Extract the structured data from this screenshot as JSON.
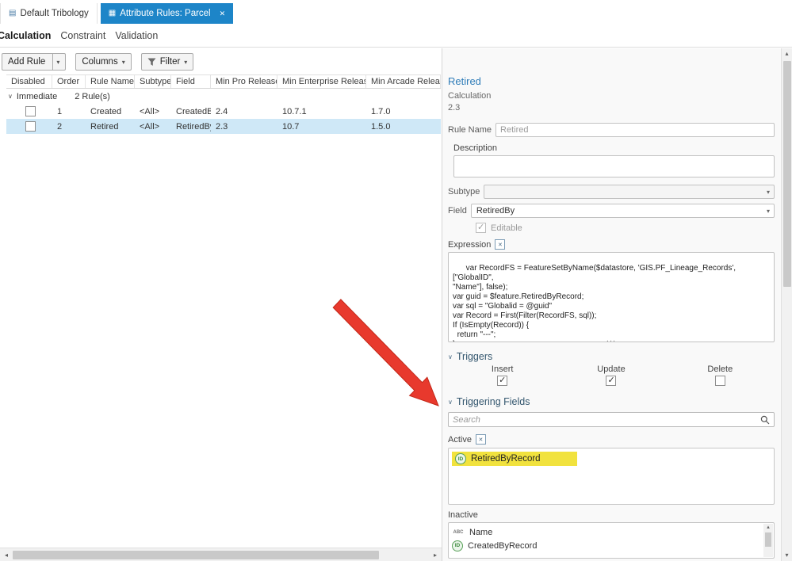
{
  "colors": {
    "accent_blue": "#1d85c8",
    "selected_row": "#cfe8f7",
    "highlight_yellow": "#f1e23e",
    "arrow_red": "#e8392d",
    "title_blue": "#2e7cb8"
  },
  "tabs": [
    {
      "label": "Default Tribology",
      "active": false
    },
    {
      "label": "Attribute Rules: Parcel",
      "active": true
    }
  ],
  "subtabs": {
    "calculation": "Calculation",
    "constraint": "Constraint",
    "validation": "Validation"
  },
  "toolbar": {
    "add_rule_label": "Add Rule",
    "columns_label": "Columns",
    "filter_label": "Filter"
  },
  "table": {
    "headers": [
      "Disabled",
      "Order",
      "Rule Name",
      "Subtype",
      "Field",
      "Min Pro Release",
      "Min Enterprise Release",
      "Min Arcade Release"
    ],
    "group_label": "Immediate",
    "group_count": "2 Rule(s)",
    "rows": [
      {
        "disabled": false,
        "order": "1",
        "rule_name": "Created",
        "subtype": "<All>",
        "field": "CreatedBy",
        "min_pro": "2.4",
        "min_enterprise": "10.7.1",
        "min_arcade": "1.7.0",
        "selected": false
      },
      {
        "disabled": false,
        "order": "2",
        "rule_name": "Retired",
        "subtype": "<All>",
        "field": "RetiredBy",
        "min_pro": "2.3",
        "min_enterprise": "10.7",
        "min_arcade": "1.5.0",
        "selected": true
      }
    ]
  },
  "details": {
    "title": "Retired",
    "subtitle": "Calculation",
    "version": "2.3",
    "rule_name_label": "Rule Name",
    "rule_name_value": "Retired",
    "description_label": "Description",
    "description_value": "",
    "subtype_label": "Subtype",
    "subtype_value": "",
    "field_label": "Field",
    "field_value": "RetiredBy",
    "editable_label": "Editable",
    "editable_checked": true,
    "expression_label": "Expression",
    "expression_code": "var RecordFS = FeatureSetByName($datastore, 'GIS.PF_Lineage_Records',[\"GlobalID\",\n\"Name\"], false);\nvar guid = $feature.RetiredByRecord;\nvar sql = \"Globalid = @guid\"\nvar Record = First(Filter(RecordFS, sql));\nIf (IsEmpty(Record)) {\n  return \"---\";\n}\nreturn Record.Name;",
    "code_more": "...",
    "triggers": {
      "label": "Triggers",
      "items": [
        {
          "label": "Insert",
          "checked": true
        },
        {
          "label": "Update",
          "checked": true
        },
        {
          "label": "Delete",
          "checked": false
        }
      ]
    },
    "triggering_fields": {
      "label": "Triggering Fields",
      "search_placeholder": "Search",
      "active_label": "Active",
      "active_items": [
        {
          "label": "RetiredByRecord",
          "icon": "id-field-icon",
          "highlighted": true
        }
      ],
      "inactive_label": "Inactive",
      "inactive_items": [
        {
          "label": "Name",
          "icon": "abc-text-field-icon"
        },
        {
          "label": "CreatedByRecord",
          "icon": "id-field-icon"
        }
      ]
    }
  }
}
